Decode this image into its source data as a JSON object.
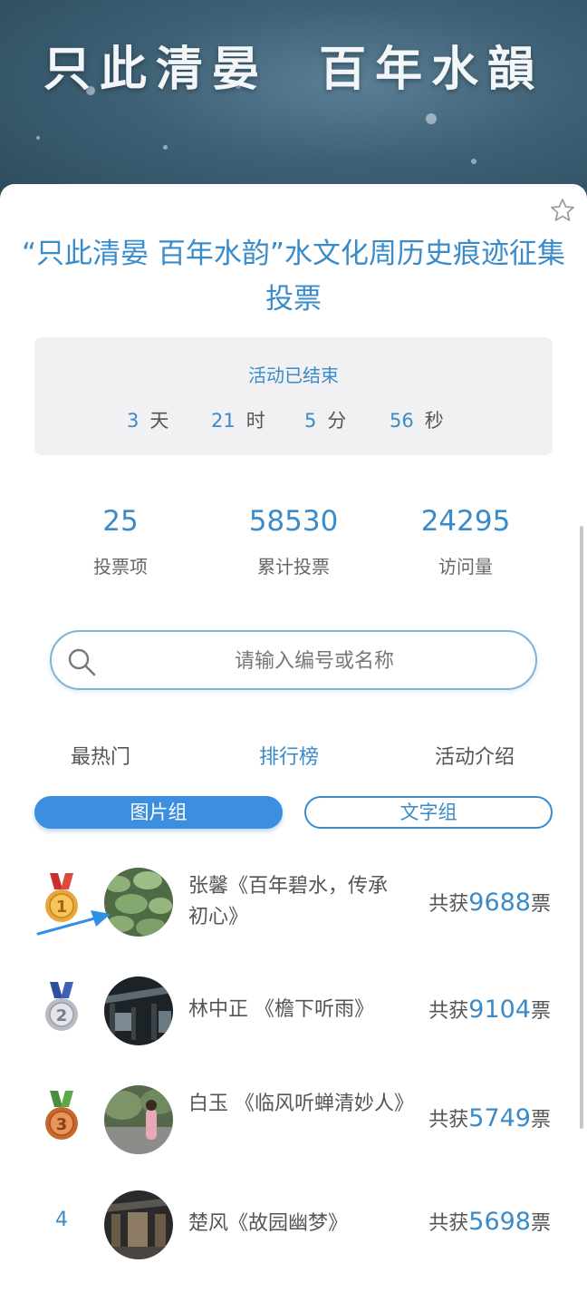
{
  "banner": {
    "title": "只此清晏  百年水韻"
  },
  "page": {
    "title": "“只此清晏 百年水韵”水文化周历史痕迹征集投票"
  },
  "countdown": {
    "status": "活动已结束",
    "days": "3",
    "days_unit": "天",
    "hours": "21",
    "hours_unit": "时",
    "minutes": "5",
    "minutes_unit": "分",
    "seconds": "56",
    "seconds_unit": "秒"
  },
  "stats": [
    {
      "value": "25",
      "label": "投票项"
    },
    {
      "value": "58530",
      "label": "累计投票"
    },
    {
      "value": "24295",
      "label": "访问量"
    }
  ],
  "search": {
    "placeholder": "请输入编号或名称"
  },
  "tabs": [
    {
      "label": "最热门"
    },
    {
      "label": "排行榜"
    },
    {
      "label": "活动介绍"
    }
  ],
  "groups": [
    {
      "label": "图片组"
    },
    {
      "label": "文字组"
    }
  ],
  "rankings": [
    {
      "rank": "1",
      "name": "张馨《百年碧水，传承初心》",
      "prefix": "共获",
      "votes": "9688",
      "suffix": "票"
    },
    {
      "rank": "2",
      "name": "林中正 《檐下听雨》",
      "prefix": "共获",
      "votes": "9104",
      "suffix": "票"
    },
    {
      "rank": "3",
      "name": "白玉 《临风听蝉清妙人》",
      "prefix": "共获",
      "votes": "5749",
      "suffix": "票"
    },
    {
      "rank": "4",
      "name": "楚风《故园幽梦》",
      "prefix": "共获",
      "votes": "5698",
      "suffix": "票"
    }
  ],
  "colors": {
    "accent": "#3a8bc9",
    "button": "#3b8ee0",
    "text": "#555555"
  }
}
